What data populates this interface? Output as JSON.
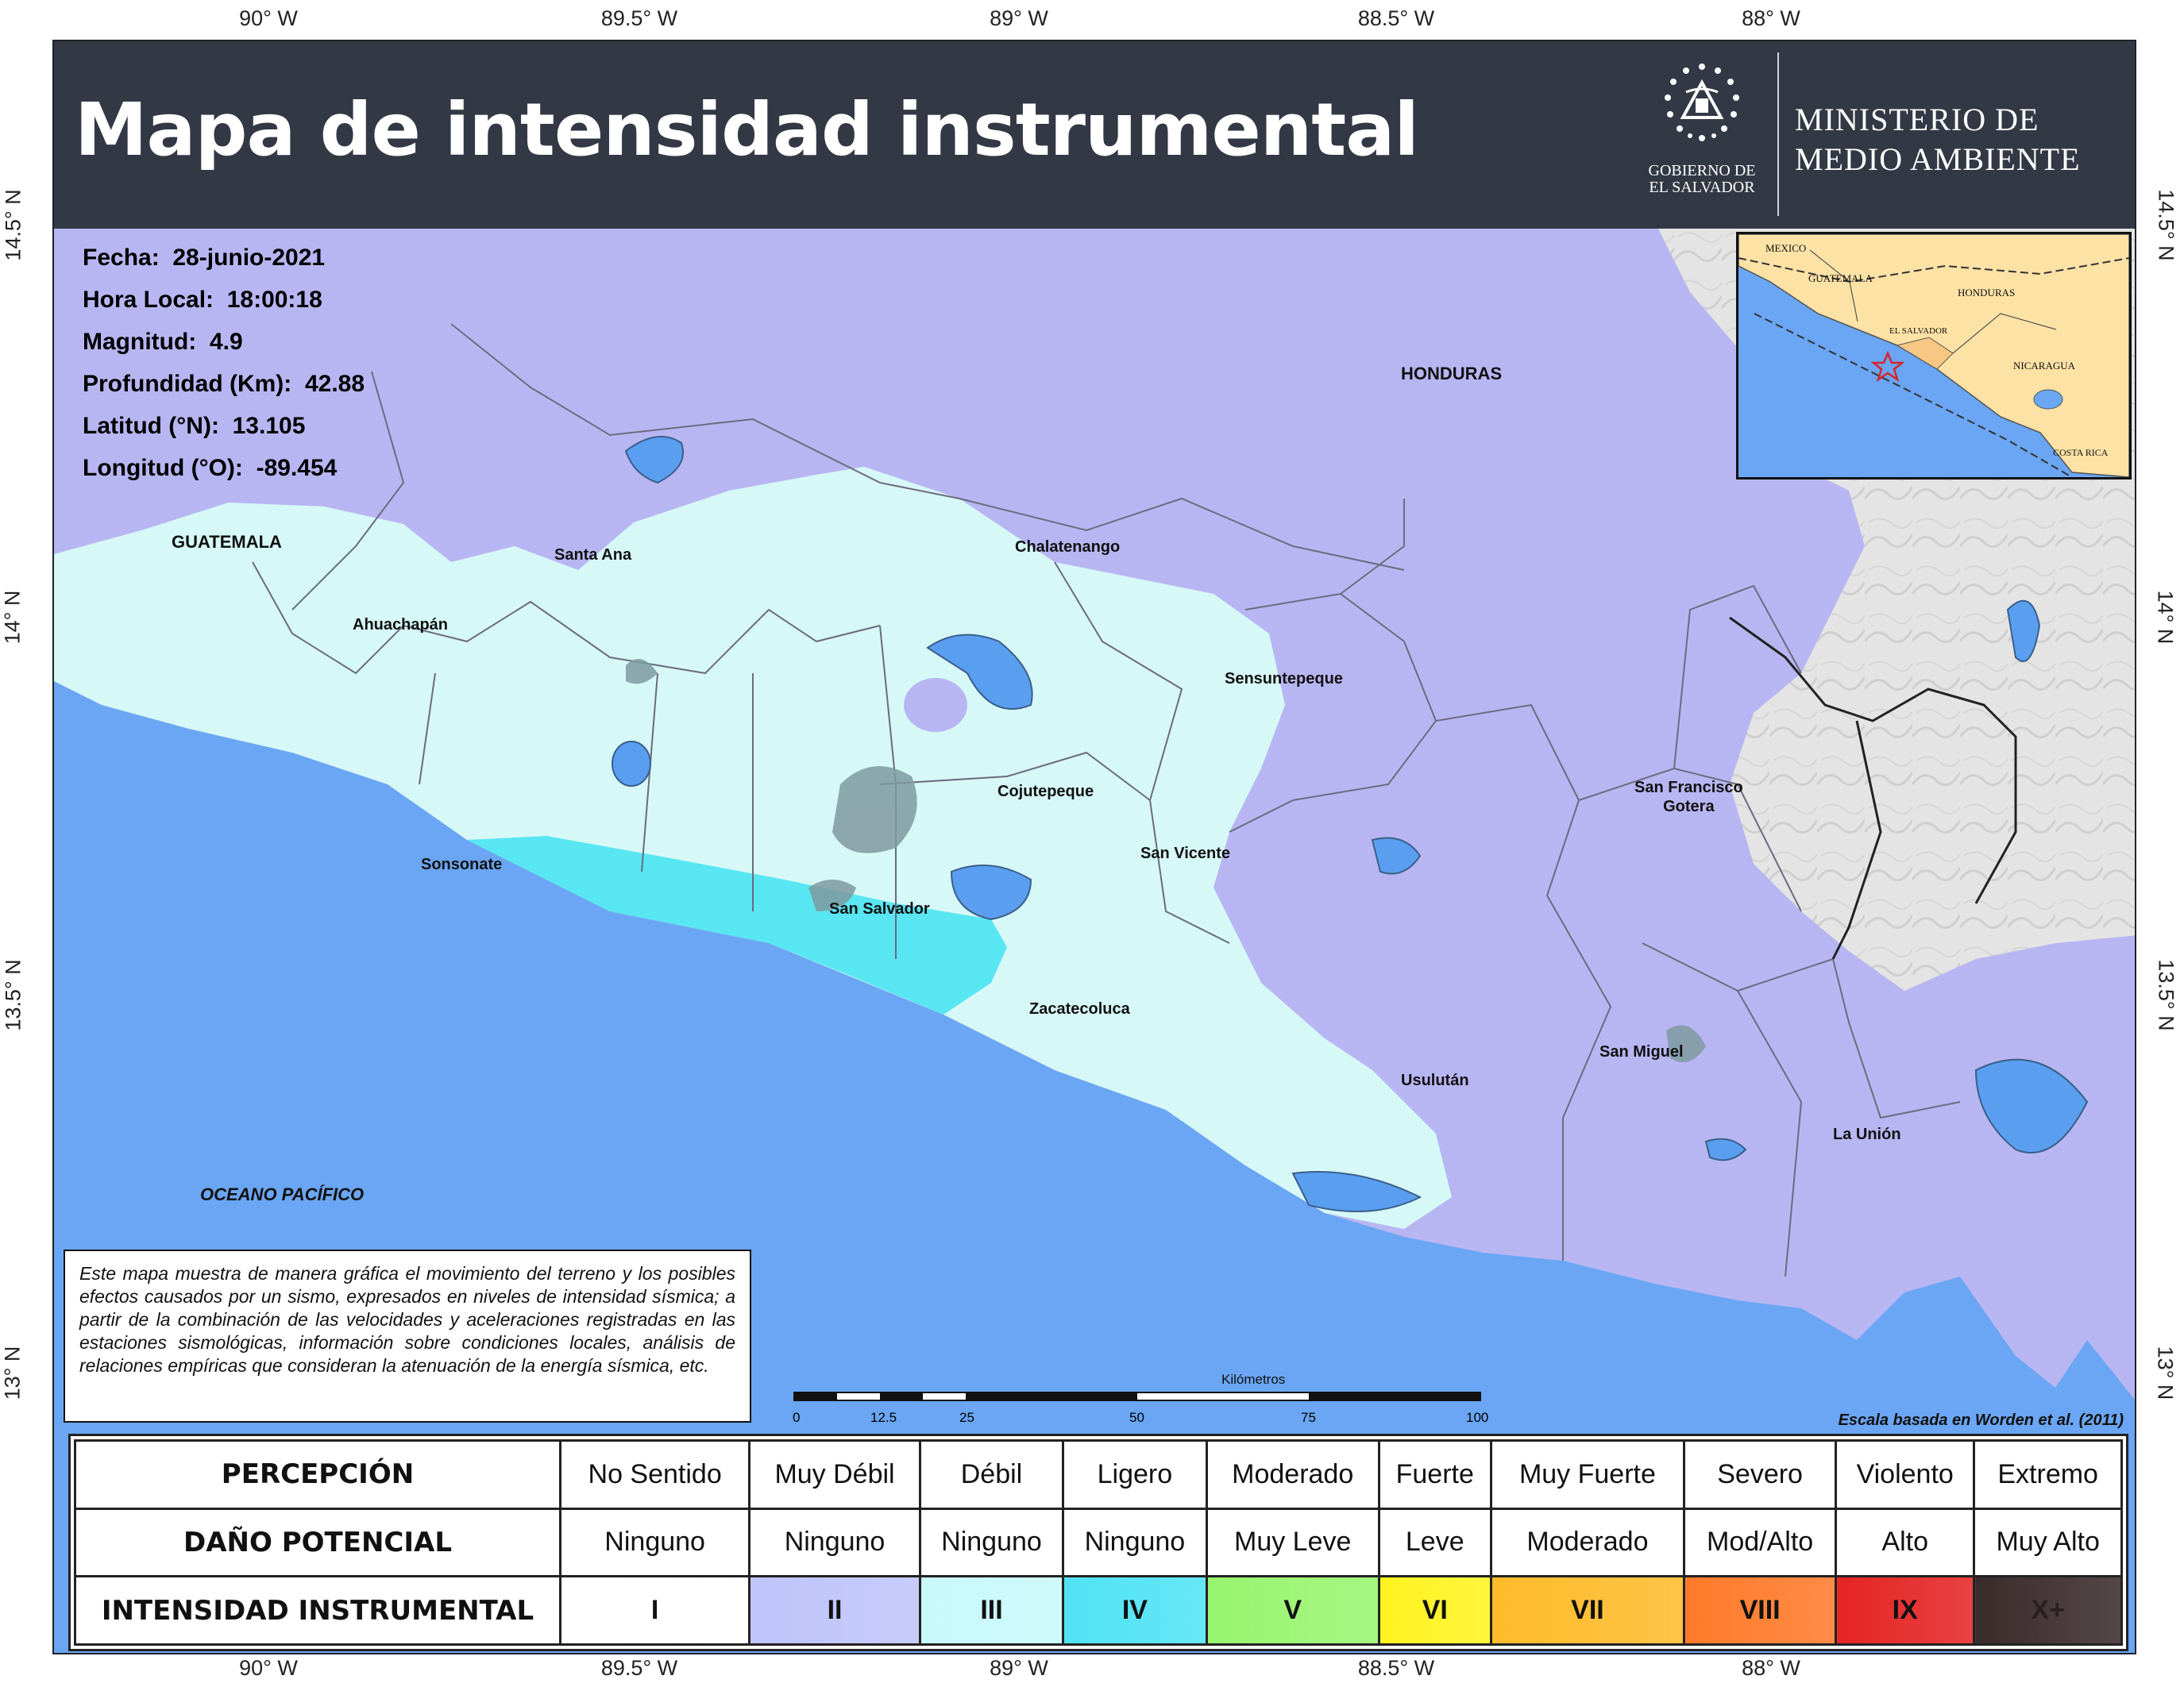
{
  "title": "Mapa de intensidad instrumental",
  "header": {
    "gov_lines": [
      "GOBIERNO DE",
      "EL SALVADOR"
    ],
    "ministry_lines": [
      "MINISTERIO DE",
      "MEDIO AMBIENTE"
    ]
  },
  "graticule": {
    "longitudes": [
      "90° W",
      "89.5° W",
      "89° W",
      "88.5° W",
      "88° W"
    ],
    "latitudes": [
      "14.5° N",
      "14° N",
      "13.5° N",
      "13° N"
    ]
  },
  "event_info": [
    {
      "label": "Fecha:",
      "value": "28-junio-2021"
    },
    {
      "label": "Hora Local:",
      "value": "18:00:18"
    },
    {
      "label": "Magnitud:",
      "value": "4.9"
    },
    {
      "label": "Profundidad (Km):",
      "value": "42.88"
    },
    {
      "label": "Latitud (°N):",
      "value": "13.105"
    },
    {
      "label": "Longitud (°O):",
      "value": "-89.454"
    }
  ],
  "places": {
    "honduras": "HONDURAS",
    "guatemala": "GUATEMALA",
    "santa_ana": "Santa Ana",
    "chalatenango": "Chalatenango",
    "ahuachapan": "Ahuachapán",
    "sensuntepeque": "Sensuntepeque",
    "cojutepeque": "Cojutepeque",
    "san_francisco_gotera": [
      "San Francisco",
      "Gotera"
    ],
    "sonsonate": "Sonsonate",
    "san_vicente": "San Vicente",
    "san_salvador": "San Salvador",
    "zacatecoluca": "Zacatecoluca",
    "san_miguel": "San Miguel",
    "usulutan": "Usulután",
    "la_union": "La Unión",
    "oceano": "OCEANO PACÍFICO"
  },
  "inset_map": {
    "labels": {
      "mexico": "MEXICO",
      "guatemala": "GUATEMALA",
      "honduras": "HONDURAS",
      "el_salvador": "EL SALVADOR",
      "nicaragua": "NICARAGUA",
      "costa_rica": "COSTA RICA"
    },
    "epicenter_marker": "star-icon"
  },
  "description": "Este mapa muestra de manera gráfica el movimiento del terreno y los posibles efectos causados por un sismo, expresados en niveles de intensidad sísmica; a partir de la combinación de las velocidades y aceleraciones registradas en las estaciones sismológicas, información sobre condiciones locales, análisis de relaciones empíricas que consideran la atenuación de la energía sísmica, etc.",
  "scale_bar": {
    "unit": "Kilómetros",
    "ticks": [
      "0",
      "12.5",
      "25",
      "50",
      "75",
      "100"
    ]
  },
  "scale_source": "Escala basada en Worden et al. (2011)",
  "legend": {
    "row_headers": [
      "PERCEPCIÓN",
      "DAÑO POTENCIAL",
      "INTENSIDAD INSTRUMENTAL"
    ],
    "perception": [
      "No Sentido",
      "Muy Débil",
      "Débil",
      "Ligero",
      "Moderado",
      "Fuerte",
      "Muy Fuerte",
      "Severo",
      "Violento",
      "Extremo"
    ],
    "damage": [
      "Ninguno",
      "Ninguno",
      "Ninguno",
      "Ninguno",
      "Muy Leve",
      "Leve",
      "Moderado",
      "Mod/Alto",
      "Alto",
      "Muy Alto"
    ],
    "intensity": [
      "I",
      "II",
      "III",
      "IV",
      "V",
      "VI",
      "VII",
      "VIII",
      "IX",
      "X+"
    ],
    "intensity_colors": [
      "#ffffff",
      "#bfc4fb",
      "#c8f9fb",
      "#4fe3f4",
      "#98f56f",
      "#fff41f",
      "#ffbb2a",
      "#ff7a2a",
      "#e52424",
      "#3a2b2b"
    ]
  },
  "map_colors": {
    "ocean": "#6aa6f3",
    "intensity_II": "#b8b6f2",
    "intensity_III": "#d6f8f7",
    "intensity_IV": "#58e6f2",
    "terrain": "#e6e6e6",
    "lakes": "#5a9ef0"
  }
}
